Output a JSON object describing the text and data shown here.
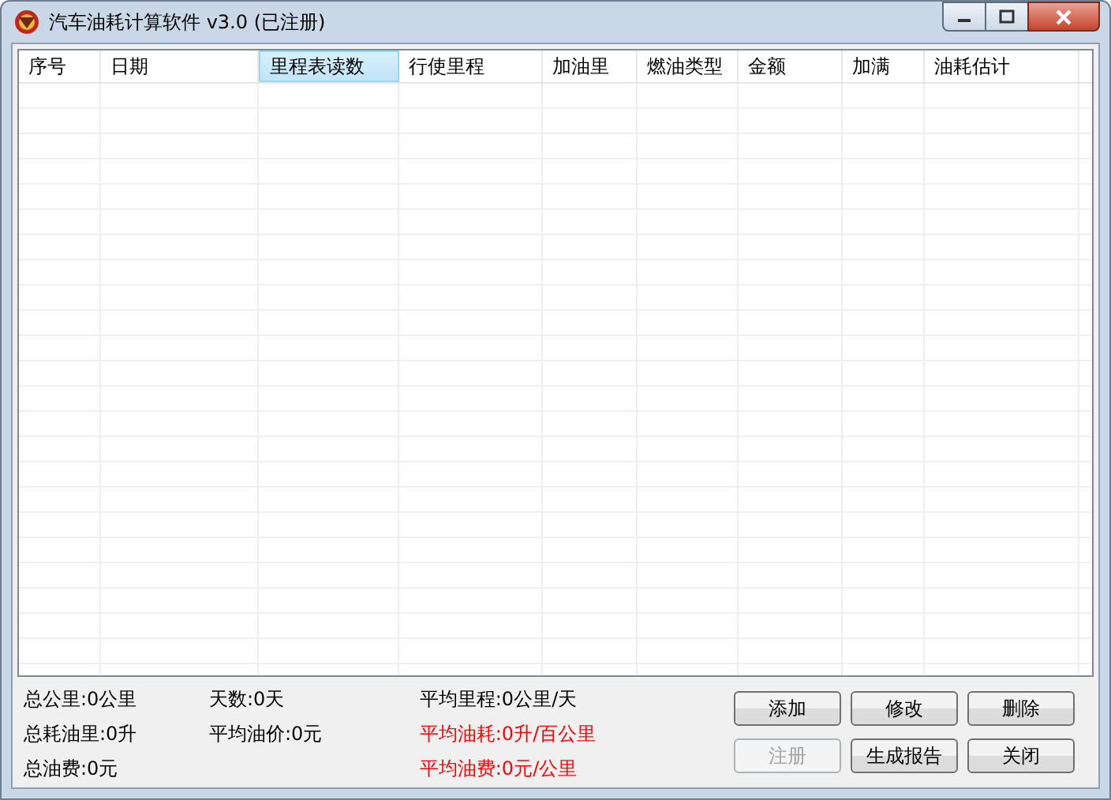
{
  "window": {
    "title": "汽车油耗计算软件 v3.0 (已注册)"
  },
  "table": {
    "columns": [
      {
        "label": "序号",
        "selected": false
      },
      {
        "label": "日期",
        "selected": false
      },
      {
        "label": "里程表读数",
        "selected": true
      },
      {
        "label": "行使里程",
        "selected": false
      },
      {
        "label": "加油里",
        "selected": false
      },
      {
        "label": "燃油类型",
        "selected": false
      },
      {
        "label": "金额",
        "selected": false
      },
      {
        "label": "加满",
        "selected": false
      },
      {
        "label": "油耗估计",
        "selected": false
      }
    ]
  },
  "stats": [
    [
      {
        "text": "总公里:0公里",
        "color": "#000000"
      },
      {
        "text": "总耗油里:0升",
        "color": "#000000"
      },
      {
        "text": "总油费:0元",
        "color": "#000000"
      }
    ],
    [
      {
        "text": "天数:0天",
        "color": "#000000"
      },
      {
        "text": "平均油价:0元",
        "color": "#000000"
      }
    ],
    [
      {
        "text": "平均里程:0公里/天",
        "color": "#000000"
      },
      {
        "text": "平均油耗:0升/百公里",
        "color": "#ff0000"
      },
      {
        "text": "平均油费:0元/公里",
        "color": "#ff0000"
      }
    ]
  ],
  "buttons": [
    {
      "label": "添加",
      "disabled": false
    },
    {
      "label": "修改",
      "disabled": false
    },
    {
      "label": "删除",
      "disabled": false
    },
    {
      "label": "注册",
      "disabled": true
    },
    {
      "label": "生成报告",
      "disabled": false
    },
    {
      "label": "关闭",
      "disabled": false
    }
  ]
}
